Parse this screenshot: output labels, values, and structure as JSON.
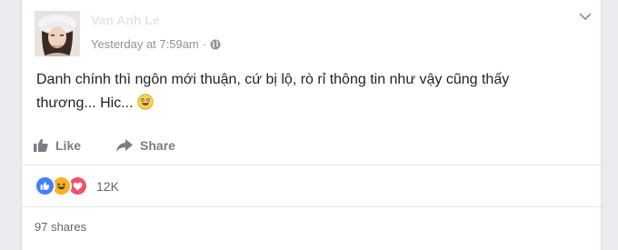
{
  "post": {
    "author": "Van Anh Le",
    "timestamp": "Yesterday at 7:59am",
    "separator": " · ",
    "privacy_icon": "globe-icon",
    "text_line1": "Danh chính thì ngôn mới thuận, cứ bị lộ, rò rỉ thông tin như vậy cũng thấy",
    "text_line2": "thương... Hic...",
    "emoji": "grinning-tongue-emoji"
  },
  "actions": {
    "like_label": "Like",
    "share_label": "Share"
  },
  "reactions": {
    "types": [
      "like",
      "haha",
      "love"
    ],
    "count": "12K"
  },
  "shares": {
    "label": "97 shares"
  },
  "colors": {
    "background": "#e9ebee",
    "card": "#ffffff",
    "text": "#1d2129",
    "muted": "#90949c",
    "like_blue": "#4080ff",
    "haha_yellow": "#f7b125",
    "love_red": "#f25268"
  }
}
